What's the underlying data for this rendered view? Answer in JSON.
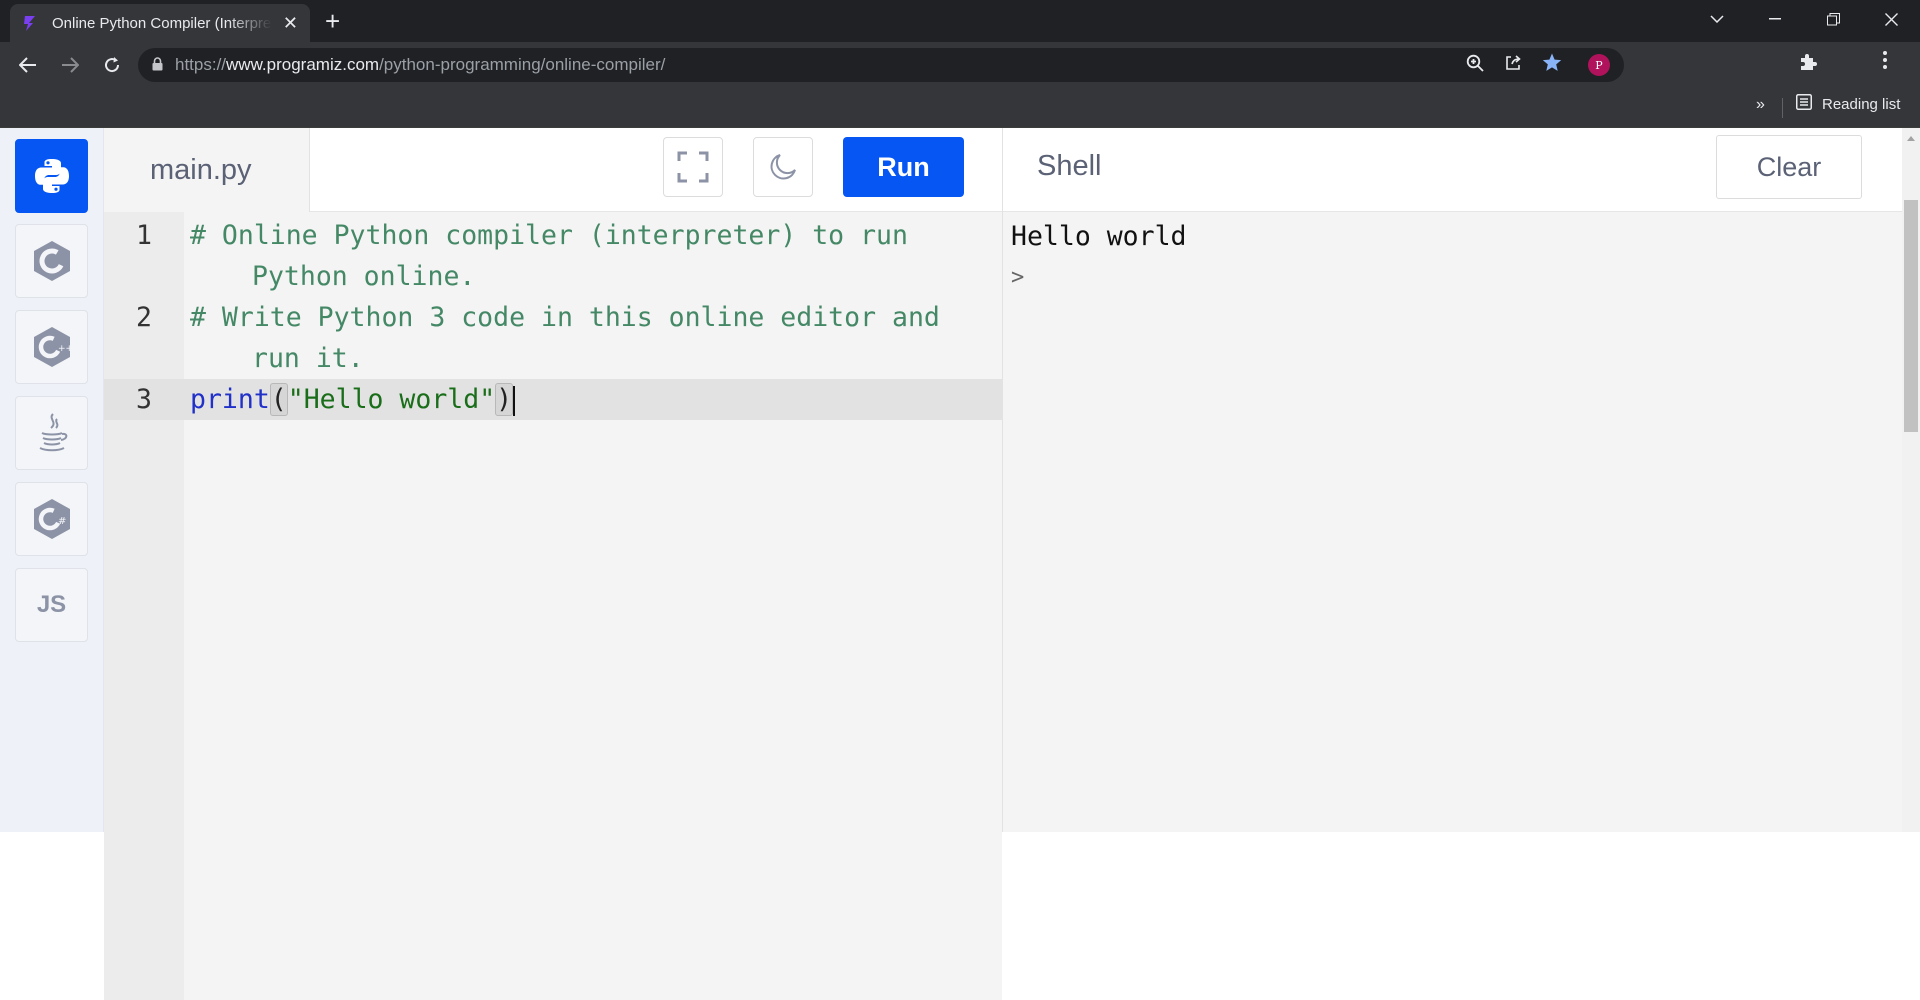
{
  "browser": {
    "tab_title": "Online Python Compiler (Interpreter)",
    "tab_close": "✕",
    "new_tab": "+",
    "url_prefix": "https://",
    "url_host": "www.programiz.com",
    "url_path": "/python-programming/online-compiler/",
    "profile_initial": "P",
    "bookmarks_more": "»",
    "reading_list": "Reading list",
    "icons": [
      "back-arrow-icon",
      "forward-arrow-icon",
      "reload-icon",
      "lock-icon",
      "zoom-icon",
      "share-icon",
      "star-icon",
      "puzzle-extension-icon",
      "kebab-menu-icon",
      "reading-list-icon"
    ],
    "accent_color": "#8ab4f8"
  },
  "languages": [
    {
      "id": "python",
      "label": "Python",
      "active": true
    },
    {
      "id": "c",
      "label": "C"
    },
    {
      "id": "cpp",
      "label": "C++"
    },
    {
      "id": "java",
      "label": "Java"
    },
    {
      "id": "csharp",
      "label": "C#"
    },
    {
      "id": "js",
      "label": "JS"
    }
  ],
  "editor": {
    "file_name": "main.py",
    "run_label": "Run",
    "run_color": "#0556f3",
    "lines": [
      {
        "no": "1",
        "text": "# Online Python compiler (interpreter) to run Python online."
      },
      {
        "no": "2",
        "text": "# Write Python 3 code in this online editor and run it."
      },
      {
        "no": "3",
        "kw": "print",
        "open": "(",
        "str": "\"Hello world\"",
        "close": ")"
      }
    ]
  },
  "shell": {
    "title": "Shell",
    "clear_label": "Clear",
    "output": "Hello world",
    "prompt": ">"
  }
}
